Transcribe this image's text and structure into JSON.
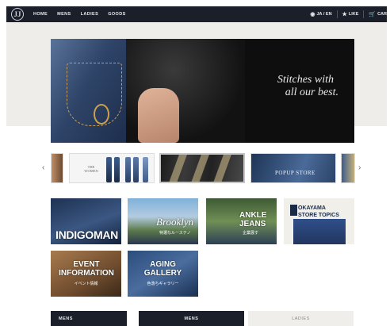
{
  "header": {
    "logo": "JJ",
    "nav": [
      "HOME",
      "MENS",
      "LADIES",
      "GOODS"
    ],
    "lang": "JA / EN",
    "like": "LIKE",
    "cart": "CAR"
  },
  "hero": {
    "line1": "Stitches with",
    "line2": "all our best."
  },
  "carousel": {
    "prev": "‹",
    "next": "›",
    "slide1_brand": "THE WOMEN",
    "slide3_text": "POPUP STORE"
  },
  "tiles": {
    "indigoman": "INDIGOMAN",
    "brooklyn": "Brooklyn",
    "brooklyn_sub": "特選なルーステノ",
    "ankle": [
      "ANKLE",
      "JEANS"
    ],
    "ankle_sub": "企業展す",
    "store": [
      "OKAYAMA",
      "STORE TOPICS"
    ],
    "event": [
      "EVENT",
      "INFORMATION"
    ],
    "event_sub": "イベント情報",
    "aging": [
      "AGING",
      "GALLERY"
    ],
    "aging_sub": "色落ちギャラリー"
  },
  "bottom": {
    "side": "MENS",
    "tab_mens": "MENS",
    "tab_ladies": "LADIES"
  }
}
